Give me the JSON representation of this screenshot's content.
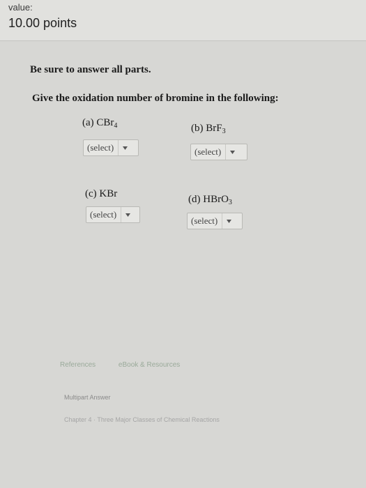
{
  "header": {
    "value_label": "value:",
    "points": "10.00 points"
  },
  "instruction": "Be sure to answer all parts.",
  "question": "Give the oxidation number of bromine in the following:",
  "parts": [
    {
      "label_prefix": "(a) CBr",
      "subscript": "4",
      "select_value": "(select)"
    },
    {
      "label_prefix": "(b) BrF",
      "subscript": "3",
      "select_value": "(select)"
    },
    {
      "label_prefix": "(c) KBr",
      "subscript": "",
      "select_value": "(select)"
    },
    {
      "label_prefix": "(d) HBrO",
      "subscript": "3",
      "select_value": "(select)"
    }
  ],
  "footer": {
    "references": "References",
    "ebook": "eBook & Resources",
    "multipart": "Multipart Answer",
    "chapter": "Chapter 4 · Three Major Classes of Chemical Reactions"
  },
  "icons": {
    "dropdown": "chevron-down-icon"
  }
}
